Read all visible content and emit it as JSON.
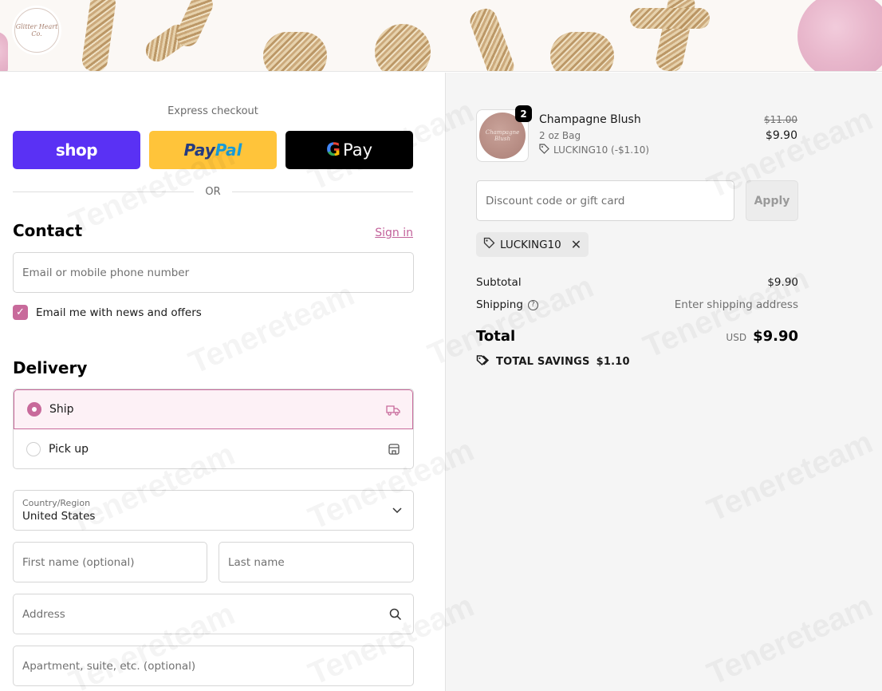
{
  "store": {
    "logo_text": "Glitter Heart Co."
  },
  "express": {
    "label": "Express checkout",
    "shop_label": "shop",
    "paypal_label_1": "Pay",
    "paypal_label_2": "Pal",
    "gpay_g": "G",
    "gpay_label": "Pay",
    "or_label": "OR"
  },
  "contact": {
    "title": "Contact",
    "signin_label": "Sign in",
    "email_placeholder": "Email or mobile phone number",
    "newsletter_label": "Email me with news and offers",
    "newsletter_checked": true
  },
  "delivery": {
    "title": "Delivery",
    "options": [
      {
        "label": "Ship",
        "selected": true,
        "icon": "truck-icon"
      },
      {
        "label": "Pick up",
        "selected": false,
        "icon": "store-icon"
      }
    ],
    "country_label": "Country/Region",
    "country_value": "United States",
    "first_name_placeholder": "First name (optional)",
    "last_name_placeholder": "Last name",
    "address_placeholder": "Address",
    "apartment_placeholder": "Apartment, suite, etc. (optional)"
  },
  "order": {
    "item": {
      "name": "Champagne Blush",
      "variant": "2 oz Bag",
      "discount": "LUCKING10 (-$1.10)",
      "quantity": "2",
      "old_price": "$11.00",
      "new_price": "$9.90",
      "thumb_text": "Champagne Blush"
    },
    "discount_placeholder": "Discount code or gift card",
    "apply_label": "Apply",
    "applied_code": "LUCKING10",
    "subtotal_label": "Subtotal",
    "subtotal_value": "$9.90",
    "shipping_label": "Shipping",
    "shipping_value": "Enter shipping address",
    "total_label": "Total",
    "currency": "USD",
    "total_value": "$9.90",
    "savings_label": "TOTAL SAVINGS",
    "savings_value": "$1.10"
  },
  "watermark": "Tenereteam",
  "colors": {
    "accent": "#c86a9b",
    "shop_pay": "#5a31f4",
    "paypal": "#ffc43a",
    "gpay": "#000000"
  }
}
